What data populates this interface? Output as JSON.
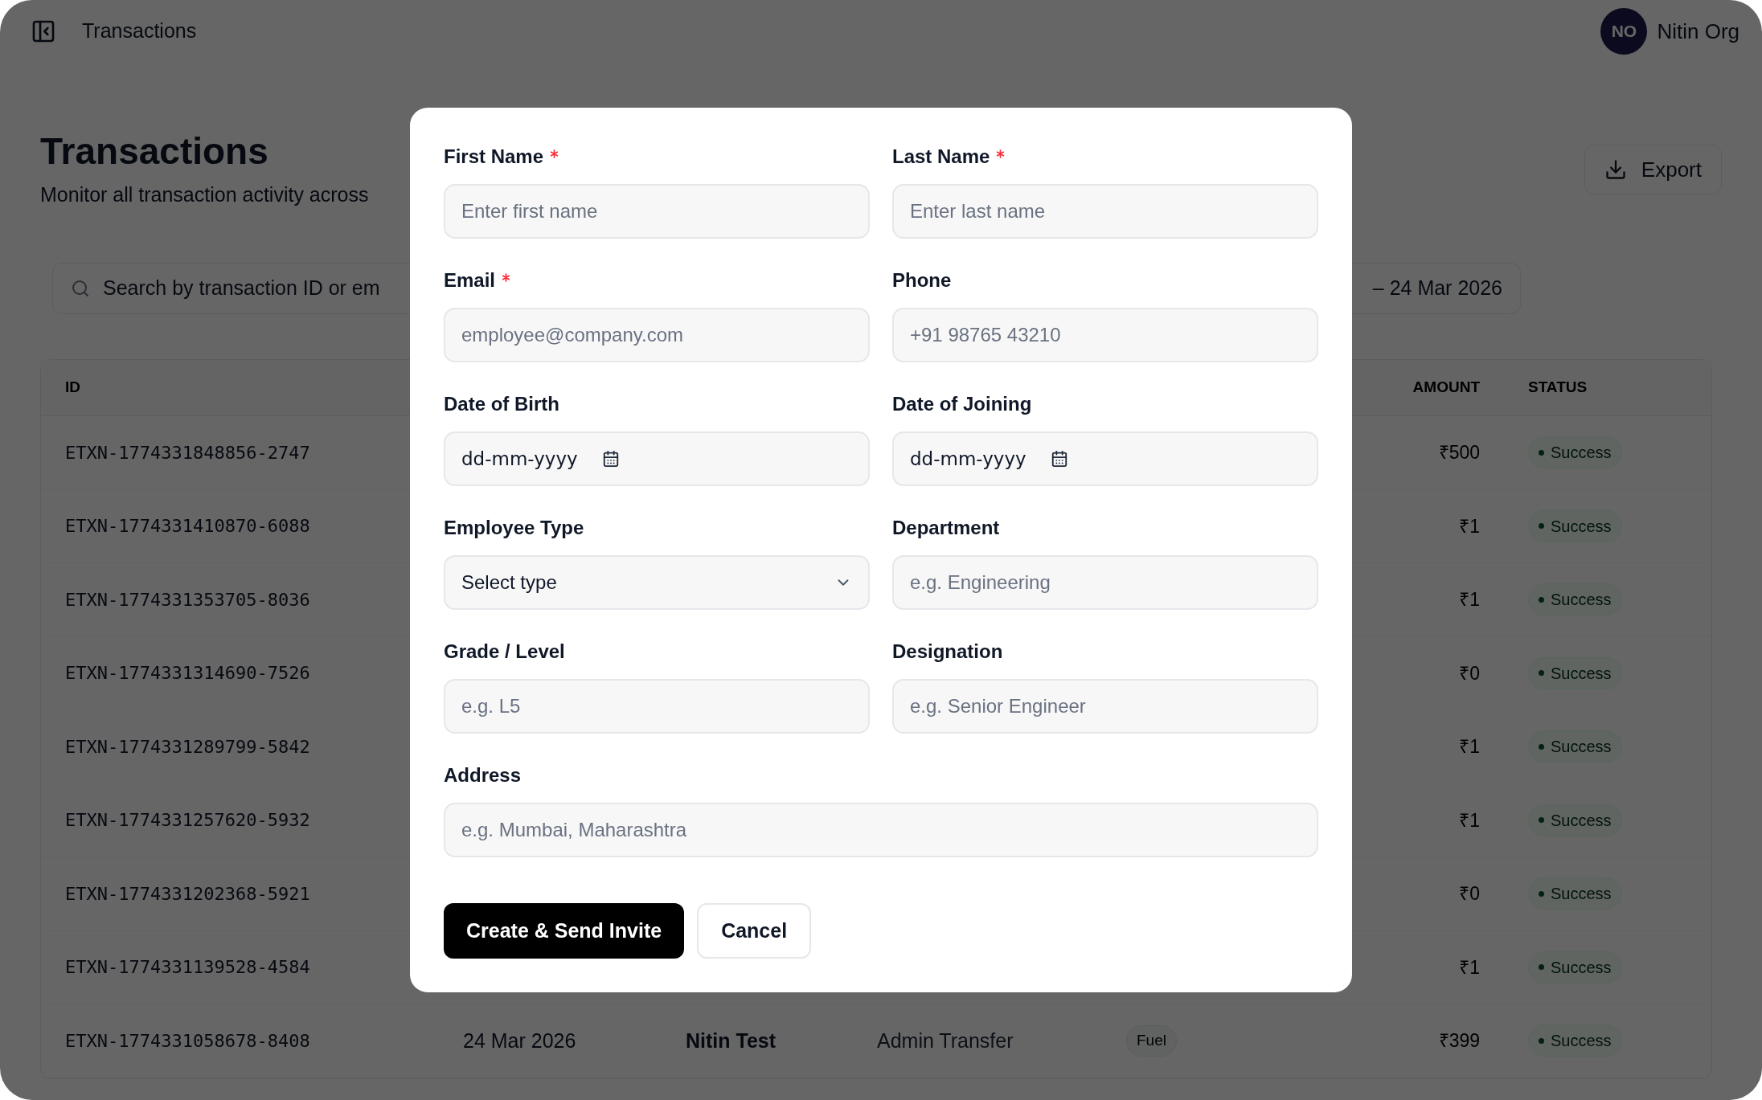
{
  "topbar": {
    "title": "Transactions",
    "user": {
      "initials": "NO",
      "name": "Nitin Org"
    }
  },
  "page": {
    "title": "Transactions",
    "subtitle": "Monitor all transaction activity across",
    "export_button": "Export"
  },
  "filters": {
    "search": {
      "placeholder": "Search by transaction ID or em"
    },
    "date_range": "– 24 Mar 2026"
  },
  "table": {
    "columns": [
      {
        "label": "ID",
        "kind": "id"
      },
      {
        "label": "AMOUNT",
        "kind": "amount"
      },
      {
        "label": "STATUS",
        "kind": "status"
      }
    ],
    "rows": [
      {
        "id": "ETXN-1774331848856-2747",
        "amount": "₹500",
        "status": "Success"
      },
      {
        "id": "ETXN-1774331410870-6088",
        "amount": "₹1",
        "status": "Success"
      },
      {
        "id": "ETXN-1774331353705-8036",
        "amount": "₹1",
        "status": "Success"
      },
      {
        "id": "ETXN-1774331314690-7526",
        "amount": "₹0",
        "status": "Success"
      },
      {
        "id": "ETXN-1774331289799-5842",
        "amount": "₹1",
        "status": "Success"
      },
      {
        "id": "ETXN-1774331257620-5932",
        "amount": "₹1",
        "status": "Success"
      },
      {
        "id": "ETXN-1774331202368-5921",
        "amount": "₹0",
        "status": "Success"
      },
      {
        "id": "ETXN-1774331139528-4584",
        "amount": "₹1",
        "status": "Success"
      },
      {
        "id": "ETXN-1774331058678-8408",
        "date": "24 Mar 2026",
        "user": "Nitin Test",
        "type": "Admin Transfer",
        "category": "Fuel",
        "amount": "₹399",
        "status": "Success"
      }
    ]
  },
  "dialog": {
    "fields": [
      {
        "label": "First Name",
        "required": true,
        "kind": "text",
        "placeholder": "Enter first name"
      },
      {
        "label": "Last Name",
        "required": true,
        "kind": "text",
        "placeholder": "Enter last name"
      },
      {
        "label": "Email",
        "required": true,
        "kind": "text",
        "placeholder": "employee@company.com"
      },
      {
        "label": "Phone",
        "required": false,
        "kind": "text",
        "placeholder": "+91 98765 43210"
      },
      {
        "label": "Date of Birth",
        "required": false,
        "kind": "date",
        "value": "dd-mm-yyyy"
      },
      {
        "label": "Date of Joining",
        "required": false,
        "kind": "date",
        "value": "dd-mm-yyyy"
      },
      {
        "label": "Employee Type",
        "required": false,
        "kind": "select",
        "value": "Select type"
      },
      {
        "label": "Department",
        "required": false,
        "kind": "text",
        "placeholder": "e.g. Engineering"
      },
      {
        "label": "Grade / Level",
        "required": false,
        "kind": "text",
        "placeholder": "e.g. L5"
      },
      {
        "label": "Designation",
        "required": false,
        "kind": "text",
        "placeholder": "e.g. Senior Engineer"
      },
      {
        "label": "Address",
        "required": false,
        "kind": "text",
        "wide": true,
        "placeholder": "e.g. Mumbai, Maharashtra"
      }
    ],
    "buttons": [
      {
        "label": "Create & Send Invite",
        "kind": "primary"
      },
      {
        "label": "Cancel",
        "kind": "secondary"
      }
    ]
  }
}
